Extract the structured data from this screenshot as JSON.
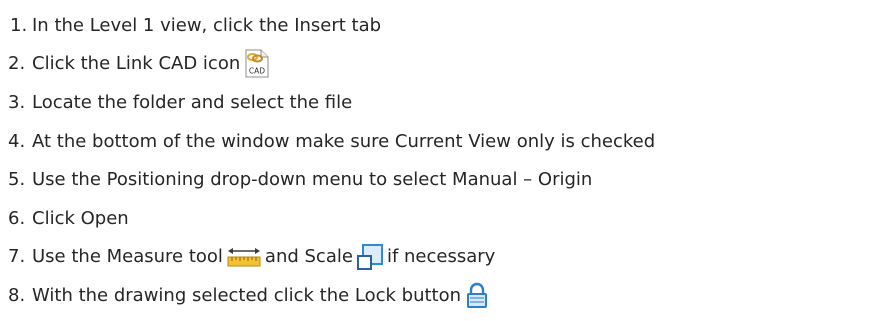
{
  "steps": [
    {
      "number": "1.",
      "text": "In the Level 1 view, click the Insert tab"
    },
    {
      "number": "2.",
      "text": "Click the Link CAD icon",
      "icon": "link-cad-icon",
      "icon_label": "CAD"
    },
    {
      "number": "3.",
      "text": "Locate the folder and select the file"
    },
    {
      "number": "4.",
      "text": "At the bottom of the window make sure Current View only is checked"
    },
    {
      "number": "5.",
      "text": "Use the Positioning drop-down menu to select Manual – Origin"
    },
    {
      "number": "6.",
      "text": "Click Open"
    },
    {
      "number": "7.",
      "text_before": "Use the Measure tool",
      "icon1": "measure-icon",
      "text_middle": "and Scale",
      "icon2": "scale-icon",
      "text_after": "if necessary"
    },
    {
      "number": "8.",
      "text": "With the drawing selected click the Lock button",
      "icon": "lock-icon"
    }
  ],
  "colors": {
    "text": "#262626",
    "measure_yellow": "#f2c233",
    "measure_arrow": "#3b3b3b",
    "scale_blue": "#2e8bd6",
    "lock_blue": "#2a7fcf",
    "cad_chain": "#e1a93a"
  }
}
